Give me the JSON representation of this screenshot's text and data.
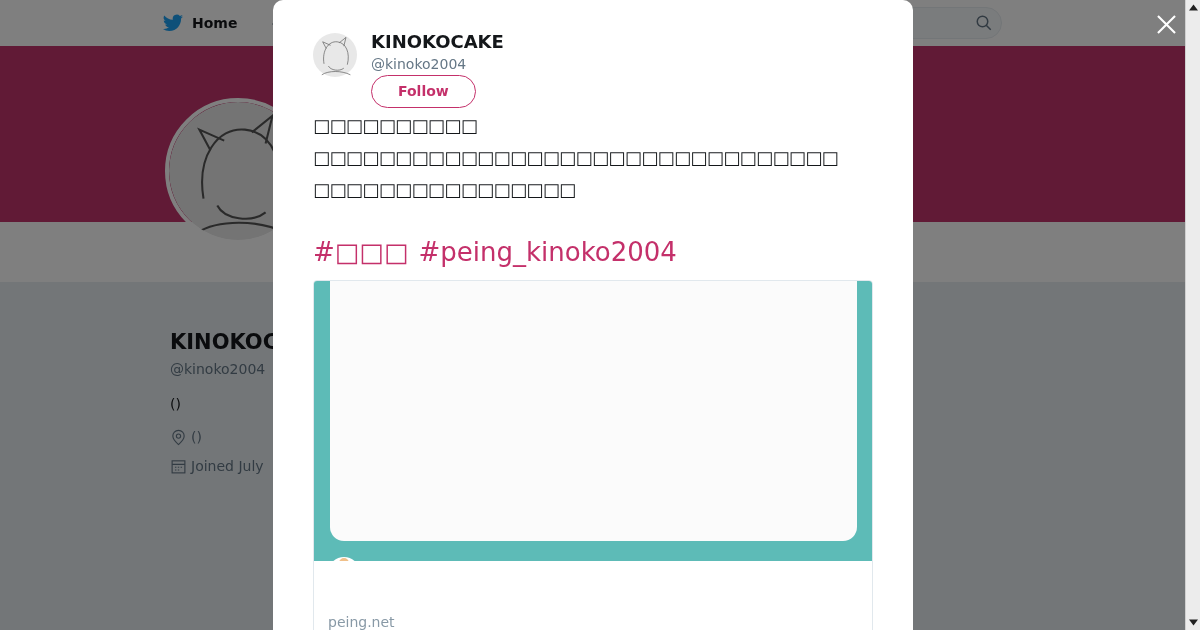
{
  "nav": {
    "home": "Home"
  },
  "profile": {
    "name": "KINOKOC",
    "handle": "@kinoko2004",
    "bio": "()",
    "location": "()",
    "joined": "Joined July"
  },
  "tweet": {
    "author_name": "KINOKOCAKE",
    "author_handle": "@kinoko2004",
    "follow_label": "Follow",
    "text": "□□□□□□□□□□\n□□□□□□□□□□□□□□□□□□□□□□□□□□□□□□□□\n□□□□□□□□□□□□□□□□",
    "hashtags": [
      "#□□□",
      "#peing_kinoko2004"
    ],
    "card": {
      "domain": "peing.net"
    }
  }
}
